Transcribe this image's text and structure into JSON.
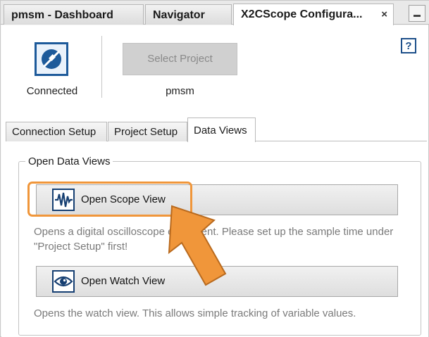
{
  "window_tabs": [
    {
      "label": "pmsm - Dashboard"
    },
    {
      "label": "Navigator"
    },
    {
      "label": "X2CScope Configura..."
    }
  ],
  "close_glyph": "×",
  "connection": {
    "label": "Connected",
    "icon": "plug-connected-icon"
  },
  "project": {
    "select_label": "Select Project",
    "name": "pmsm"
  },
  "help_glyph": "?",
  "section_tabs": [
    {
      "label": "Connection Setup"
    },
    {
      "label": "Project Setup"
    },
    {
      "label": "Data Views",
      "active": true
    }
  ],
  "data_views": {
    "legend": "Open Data Views",
    "scope_button": "Open Scope View",
    "scope_desc": "Opens a digital oscilloscope equivalent. Please set up the sample time under \"Project Setup\" first!",
    "watch_button": "Open Watch View",
    "watch_desc": "Opens the watch view. This allows simple tracking of variable values."
  },
  "colors": {
    "accent_orange": "#f0963a",
    "icon_blue": "#1d5a9a"
  }
}
